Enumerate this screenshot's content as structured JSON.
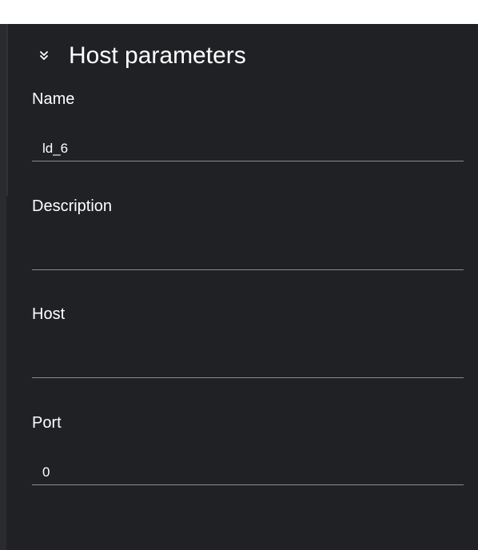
{
  "section": {
    "title": "Host parameters",
    "chevron_icon": "chevron-double-down-icon"
  },
  "fields": {
    "name": {
      "label": "Name",
      "value": "ld_6"
    },
    "description": {
      "label": "Description",
      "value": ""
    },
    "host": {
      "label": "Host",
      "value": ""
    },
    "port": {
      "label": "Port",
      "value": "0"
    }
  },
  "colors": {
    "background": "#202125",
    "text": "#ffffff",
    "underline": "#8a8b8f"
  }
}
